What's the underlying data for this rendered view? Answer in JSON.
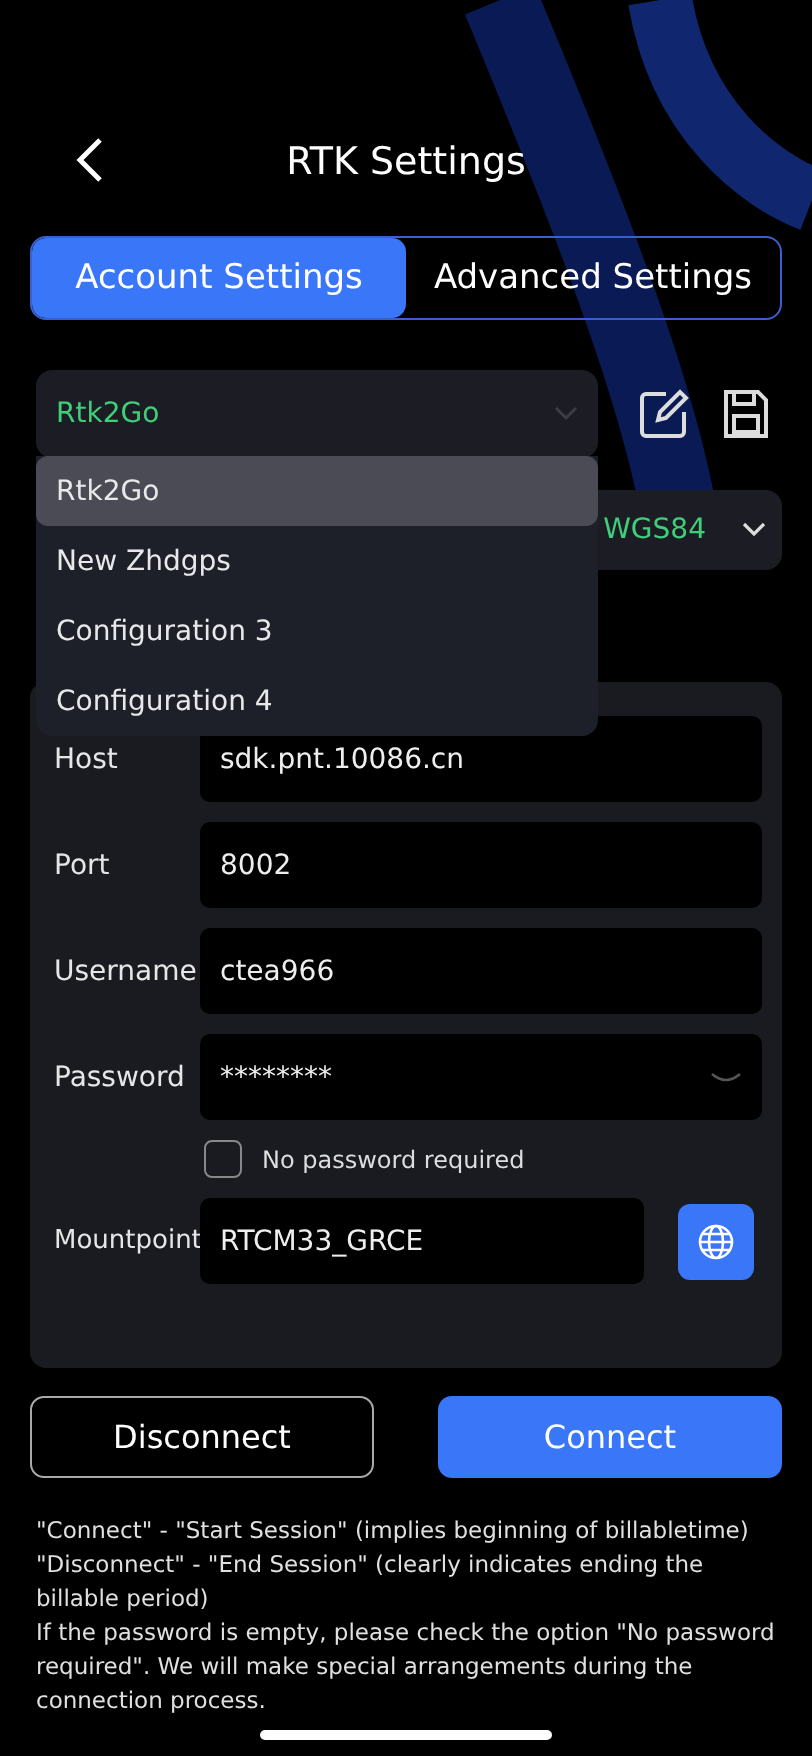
{
  "header": {
    "title": "RTK Settings"
  },
  "tabs": [
    {
      "label": "Account  Settings",
      "selected": true
    },
    {
      "label": "Advanced Settings",
      "selected": false
    }
  ],
  "profile_select": {
    "value": "Rtk2Go",
    "expanded": true,
    "options": [
      {
        "label": "Rtk2Go",
        "selected": true
      },
      {
        "label": "New Zhdgps",
        "selected": false
      },
      {
        "label": "Configuration 3",
        "selected": false
      },
      {
        "label": "Configuration 4",
        "selected": false
      }
    ]
  },
  "coordinate_select": {
    "value": "WGS84"
  },
  "form": {
    "fields": [
      {
        "label": "Host",
        "value": "sdk.pnt.10086.cn",
        "kind": "text"
      },
      {
        "label": "Port",
        "value": "8002",
        "kind": "text"
      },
      {
        "label": "Username",
        "value": "ctea966",
        "kind": "text"
      },
      {
        "label": "Password",
        "value": "********",
        "kind": "password"
      }
    ],
    "no_password": {
      "label": "No password required",
      "checked": false
    },
    "mountpoint": {
      "label": "Mountpoint",
      "value": "RTCM33_GRCE"
    }
  },
  "buttons": [
    {
      "label": "Disconnect",
      "kind": "outline"
    },
    {
      "label": "Connect",
      "kind": "primary"
    }
  ],
  "notes": [
    "\"Connect\" - \"Start Session\" (implies beginning of billabletime)",
    "\"Disconnect\" - \"End Session\" (clearly indicates ending the billable period)",
    "If the password is empty, please check the option \"No password required\". We will make special arrangements during the connection process."
  ]
}
